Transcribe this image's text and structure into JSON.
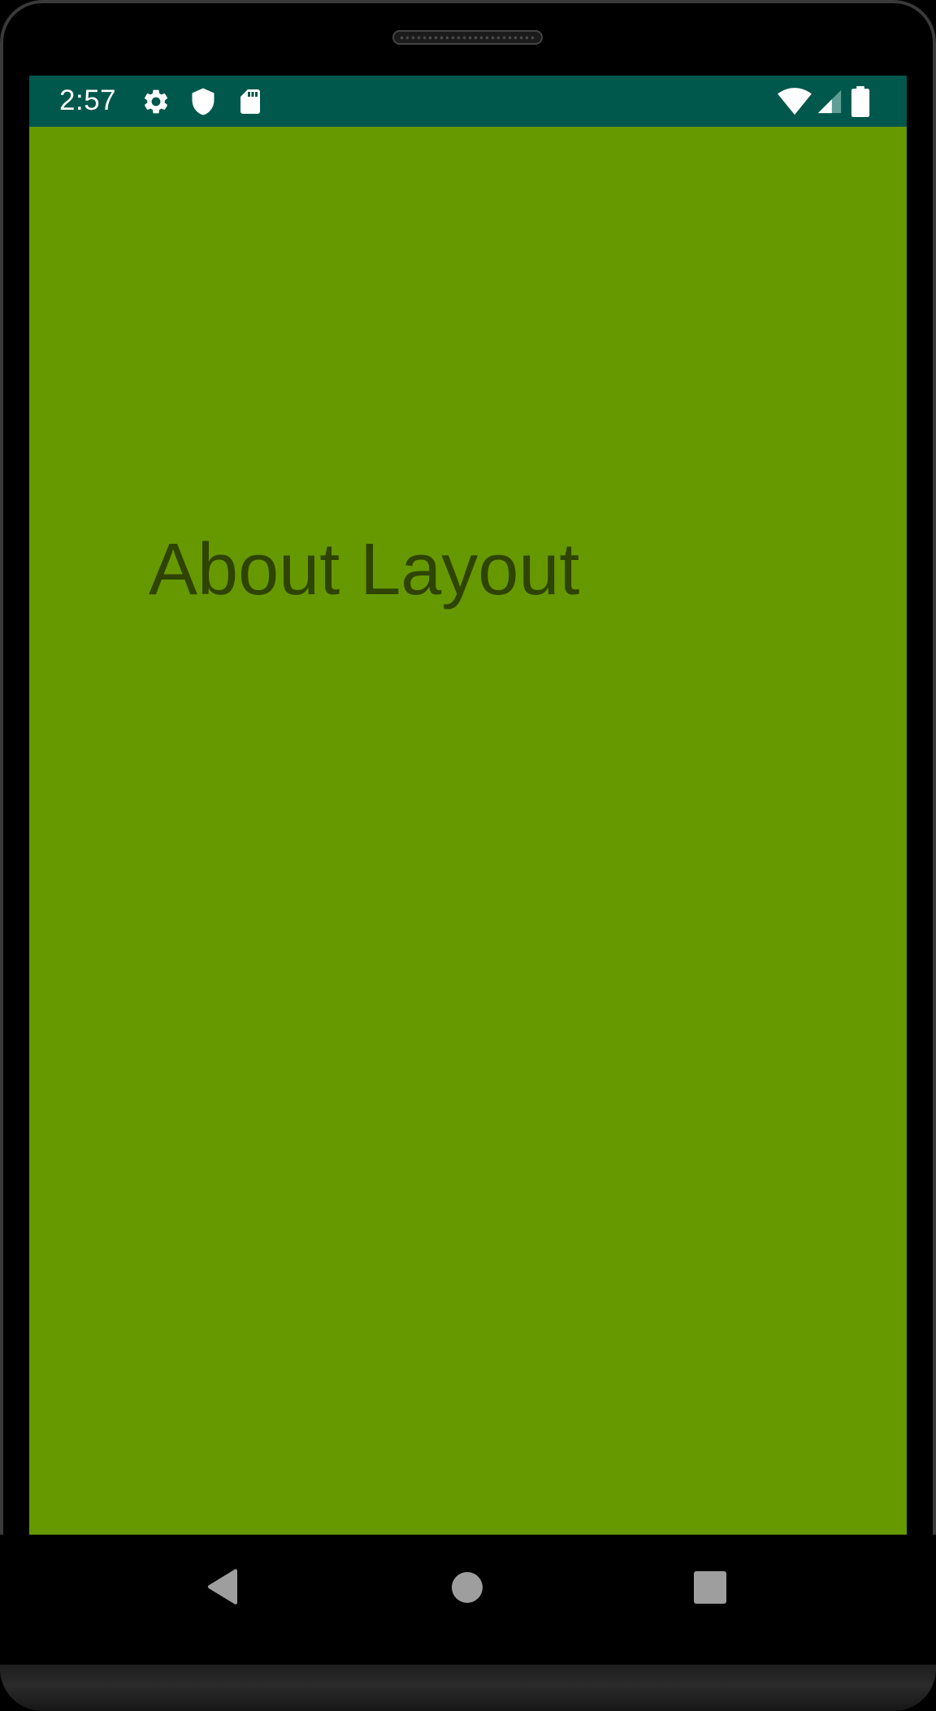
{
  "status_bar": {
    "time": "2:57",
    "left_icons": [
      "gear-icon",
      "shield-icon",
      "sd-card-icon"
    ],
    "right_icons": [
      "wifi-icon",
      "cellular-signal-icon",
      "battery-icon"
    ],
    "background_color": "#00574b"
  },
  "main": {
    "title": "About Layout",
    "background_color": "#669900",
    "text_color": "#2e4400"
  },
  "nav_bar": {
    "buttons": [
      "back-icon",
      "home-icon",
      "recents-icon"
    ],
    "button_color": "#9e9e9e"
  }
}
